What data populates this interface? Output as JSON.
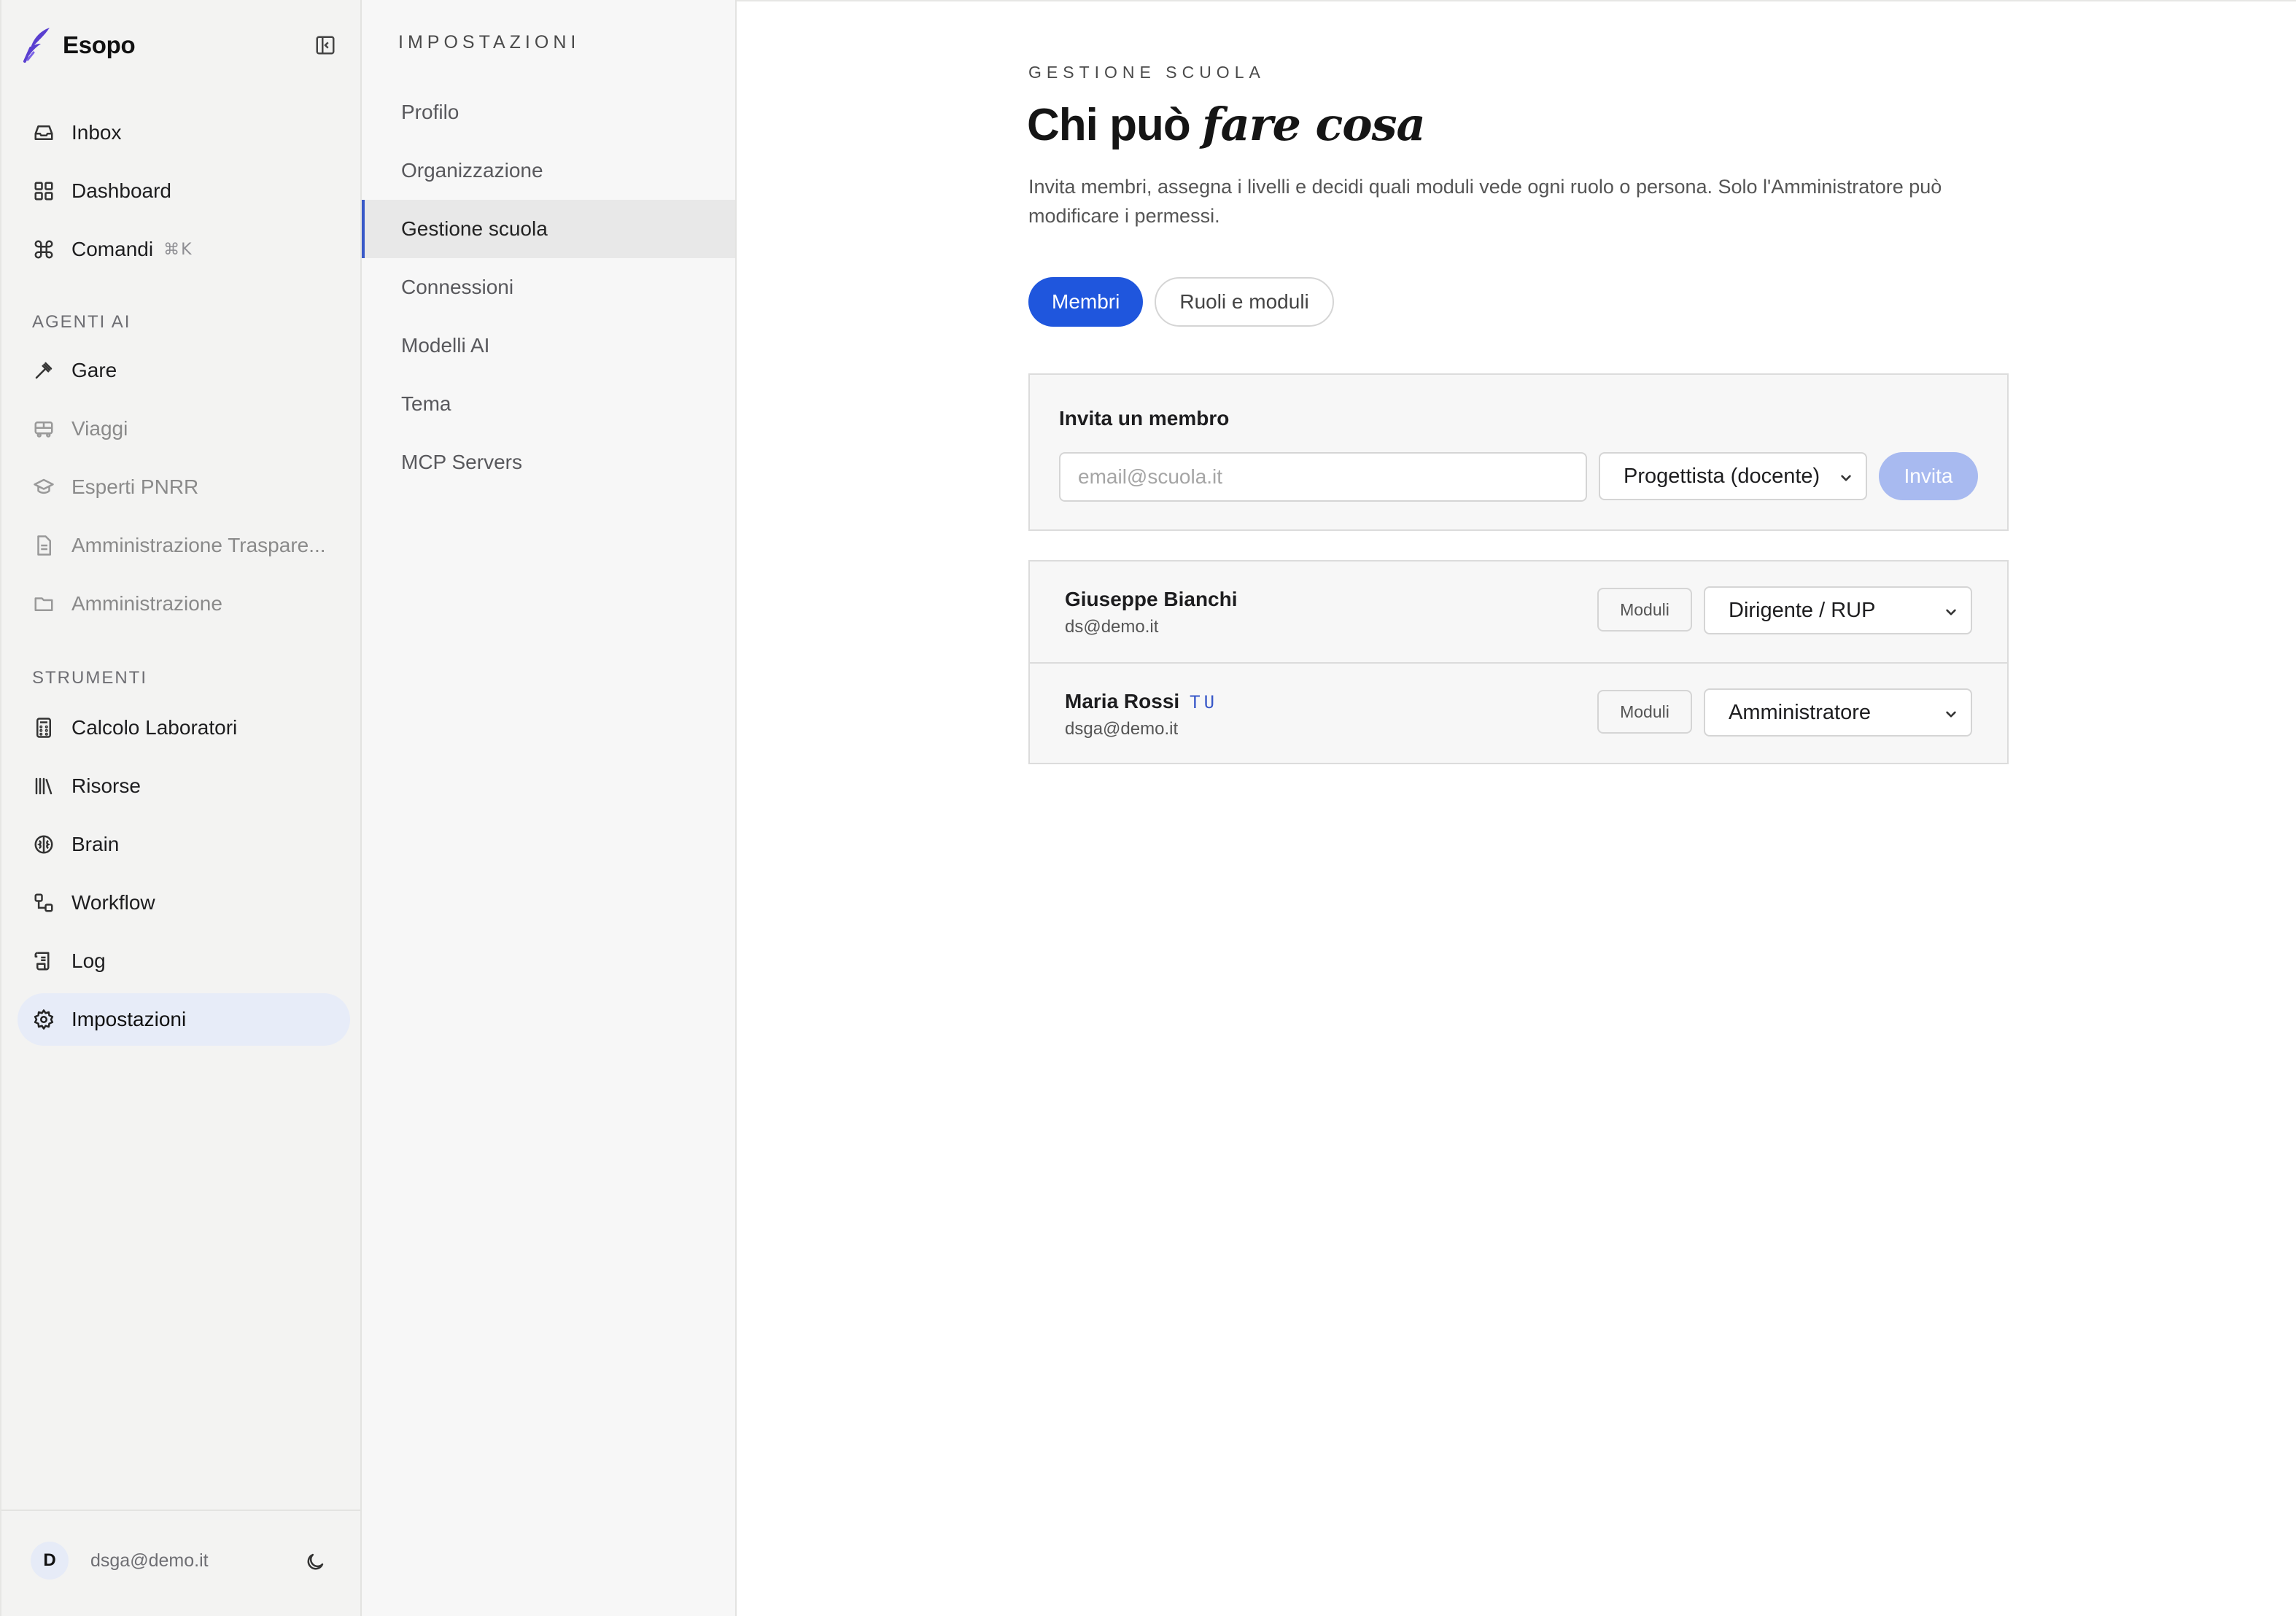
{
  "app": {
    "name": "Esopo",
    "colors": {
      "accent": "#1f56dd",
      "accent_disabled": "#a8baf0",
      "logo": "#5a3fd0"
    }
  },
  "sidebar": {
    "collapse_icon": "sidebar-collapse-icon",
    "primary": [
      {
        "label": "Inbox",
        "icon": "inbox-icon"
      },
      {
        "label": "Dashboard",
        "icon": "grid-icon"
      },
      {
        "label": "Comandi",
        "icon": "command-icon",
        "shortcut": "⌘K"
      }
    ],
    "section_agents": "AGENTI AI",
    "agents": [
      {
        "label": "Gare",
        "icon": "gavel-icon"
      },
      {
        "label": "Viaggi",
        "icon": "bus-icon"
      },
      {
        "label": "Esperti PNRR",
        "icon": "graduation-cap-icon"
      },
      {
        "label": "Amministrazione Traspare...",
        "icon": "document-icon"
      },
      {
        "label": "Amministrazione",
        "icon": "folder-icon"
      }
    ],
    "section_tools": "STRUMENTI",
    "tools": [
      {
        "label": "Calcolo Laboratori",
        "icon": "calculator-icon"
      },
      {
        "label": "Risorse",
        "icon": "library-icon"
      },
      {
        "label": "Brain",
        "icon": "brain-icon"
      },
      {
        "label": "Workflow",
        "icon": "workflow-icon"
      },
      {
        "label": "Log",
        "icon": "scroll-icon"
      },
      {
        "label": "Impostazioni",
        "icon": "gear-icon"
      }
    ],
    "user": {
      "initial": "D",
      "email": "dsga@demo.it",
      "theme_icon": "moon-icon"
    }
  },
  "settings_nav": {
    "title": "IMPOSTAZIONI",
    "items": [
      "Profilo",
      "Organizzazione",
      "Gestione scuola",
      "Connessioni",
      "Modelli AI",
      "Tema",
      "MCP Servers"
    ],
    "active": "Gestione scuola"
  },
  "main": {
    "eyebrow": "GESTIONE SCUOLA",
    "title_plain": "Chi può",
    "title_italic": "fare cosa",
    "description": "Invita membri, assegna i livelli e decidi quali moduli vede ogni ruolo o persona. Solo l'Amministratore può modificare i permessi.",
    "tabs": [
      {
        "label": "Membri",
        "active": true
      },
      {
        "label": "Ruoli e moduli",
        "active": false
      }
    ],
    "invite": {
      "title": "Invita un membro",
      "email_placeholder": "email@scuola.it",
      "email_value": "",
      "role_selected": "Progettista (docente)",
      "button": "Invita"
    },
    "members": [
      {
        "name": "Giuseppe Bianchi",
        "tag": "",
        "email": "ds@demo.it",
        "moduli_label": "Moduli",
        "role": "Dirigente / RUP"
      },
      {
        "name": "Maria Rossi",
        "tag": "TU",
        "email": "dsga@demo.it",
        "moduli_label": "Moduli",
        "role": "Amministratore"
      }
    ]
  }
}
